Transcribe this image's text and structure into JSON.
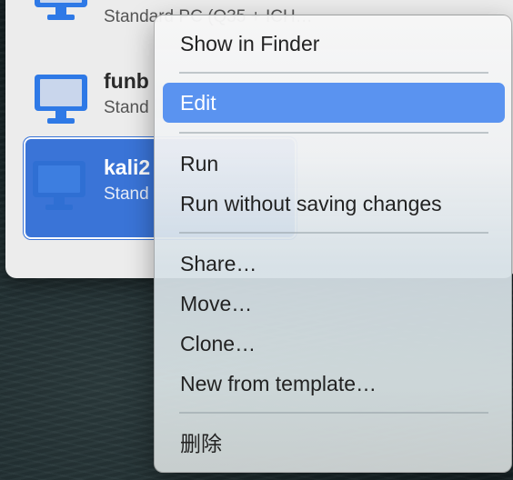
{
  "vm_list": {
    "items": [
      {
        "name": "",
        "subtitle": "Standard PC (Q35 + ICH…"
      },
      {
        "name": "funb",
        "subtitle": "Stand"
      },
      {
        "name": "kali2",
        "subtitle": "Stand",
        "selected": true
      }
    ]
  },
  "context_menu": {
    "items": [
      {
        "label": "Show in Finder"
      },
      {
        "label": "Edit",
        "highlighted": true
      },
      {
        "label": "Run"
      },
      {
        "label": "Run without saving changes"
      },
      {
        "label": "Share…"
      },
      {
        "label": "Move…"
      },
      {
        "label": "Clone…"
      },
      {
        "label": "New from template…"
      },
      {
        "label": "删除"
      }
    ]
  },
  "colors": {
    "selection": "#3a74d7",
    "menu_highlight": "#5a93f0",
    "icon_blue": "#2e79e6"
  },
  "icons": [
    "monitor-icon",
    "monitor-icon",
    "monitor-icon"
  ]
}
